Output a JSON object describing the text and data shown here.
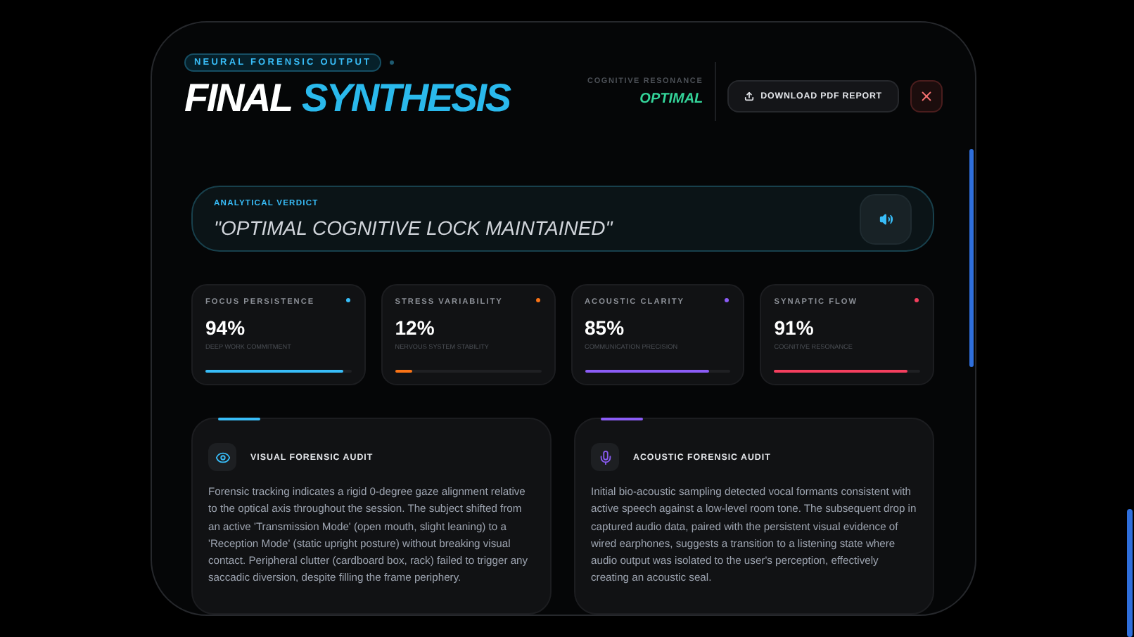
{
  "header": {
    "badge": "NEURAL FORENSIC OUTPUT",
    "title_first": "FINAL",
    "title_second": "SYNTHESIS",
    "status_label": "COGNITIVE RESONANCE",
    "status_value": "OPTIMAL",
    "download_button": "DOWNLOAD PDF REPORT"
  },
  "verdict": {
    "label": "ANALYTICAL VERDICT",
    "quote": "\"OPTIMAL COGNITIVE LOCK MAINTAINED\""
  },
  "metrics": [
    {
      "title": "FOCUS PERSISTENCE",
      "value": "94%",
      "caption": "DEEP WORK COMMITMENT",
      "level": 0.94,
      "color": "#38bdf8"
    },
    {
      "title": "STRESS VARIABILITY",
      "value": "12%",
      "caption": "NERVOUS SYSTEM STABILITY",
      "level": 0.12,
      "color": "#f97316"
    },
    {
      "title": "ACOUSTIC CLARITY",
      "value": "85%",
      "caption": "COMMUNICATION PRECISION",
      "level": 0.85,
      "color": "#8b5cf6"
    },
    {
      "title": "SYNAPTIC FLOW",
      "value": "91%",
      "caption": "COGNITIVE RESONANCE",
      "level": 0.91,
      "color": "#f43f5e"
    }
  ],
  "audits": [
    {
      "kind": "visual",
      "title": "VISUAL FORENSIC AUDIT",
      "color": "#38bdf8",
      "text": "Forensic tracking indicates a rigid 0-degree gaze alignment relative to the optical axis throughout the session. The subject shifted from an active 'Transmission Mode' (open mouth, slight leaning) to a 'Reception Mode' (static upright posture) without breaking visual contact. Peripheral clutter (cardboard box, rack) failed to trigger any saccadic diversion, despite filling the frame periphery."
    },
    {
      "kind": "acoustic",
      "title": "ACOUSTIC FORENSIC AUDIT",
      "color": "#8b5cf6",
      "text": "Initial bio-acoustic sampling detected vocal formants consistent with active speech against a low-level room tone. The subsequent drop in captured audio data, paired with the persistent visual evidence of wired earphones, suggests a transition to a listening state where audio output was isolated to the user's perception, effectively creating an acoustic seal."
    }
  ]
}
